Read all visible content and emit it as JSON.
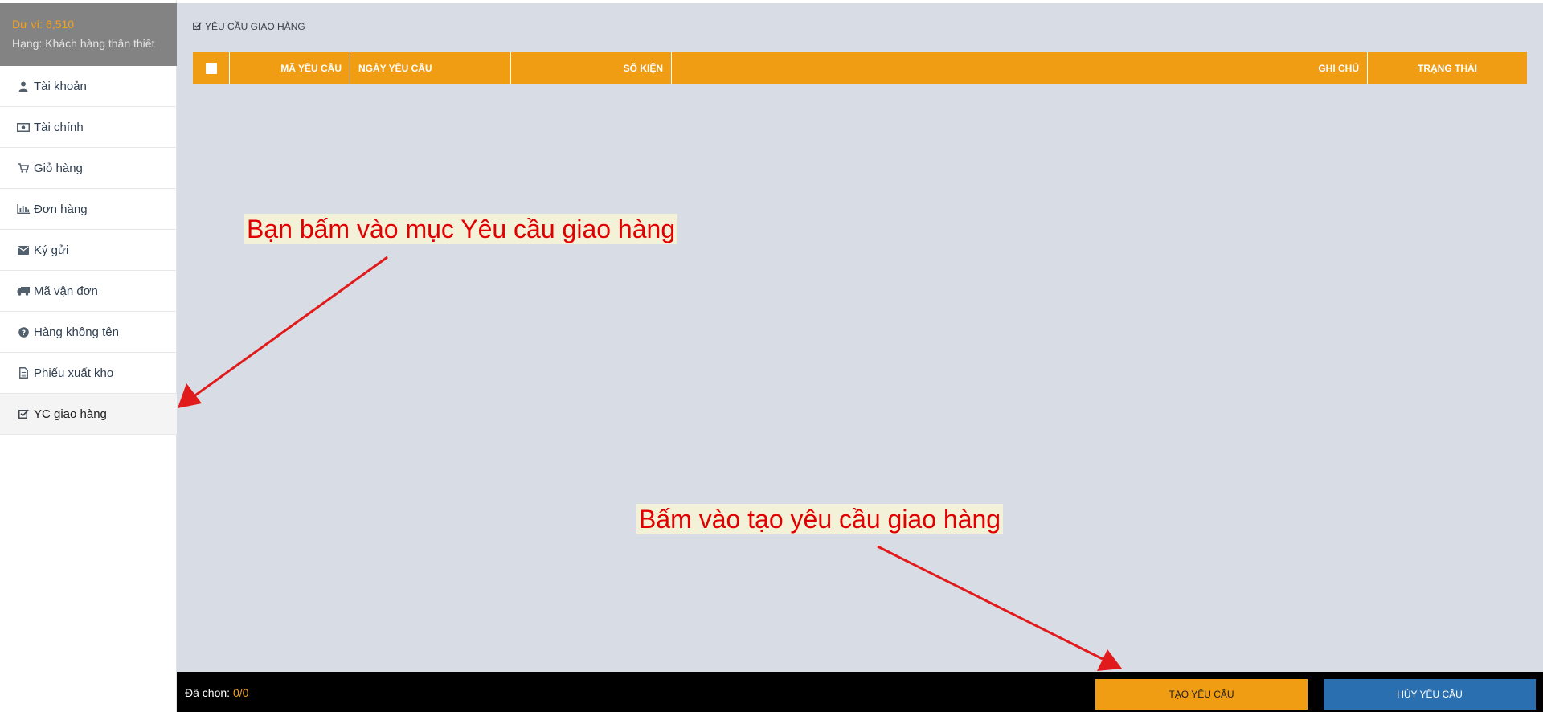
{
  "sidebar": {
    "balance_label": "Dư ví:",
    "balance_value": "6,510",
    "rank": "Hạng: Khách hàng thân thiết",
    "items": [
      {
        "label": "Tài khoản",
        "icon": "user-icon"
      },
      {
        "label": "Tài chính",
        "icon": "money-icon"
      },
      {
        "label": "Giỏ hàng",
        "icon": "cart-icon"
      },
      {
        "label": "Đơn hàng",
        "icon": "bar-chart-icon"
      },
      {
        "label": "Ký gửi",
        "icon": "envelope-icon"
      },
      {
        "label": "Mã vận đơn",
        "icon": "truck-icon"
      },
      {
        "label": "Hàng không tên",
        "icon": "question-circle-icon"
      },
      {
        "label": "Phiếu xuất kho",
        "icon": "file-icon"
      },
      {
        "label": "YC giao hàng",
        "icon": "check-square-icon",
        "active": true
      }
    ]
  },
  "main": {
    "section_title": "YÊU CẦU GIAO HÀNG",
    "table": {
      "headers": [
        "MÃ YÊU CẦU",
        "NGÀY YÊU CẦU",
        "SỐ KIỆN",
        "GHI CHÚ",
        "TRẠNG THÁI"
      ],
      "rows": []
    }
  },
  "footer": {
    "selected_label": "Đã chọn:",
    "selected_count": "0/0",
    "create_button": "TẠO YÊU CẦU",
    "cancel_button": "HỦY YÊU CẦU"
  },
  "annotations": {
    "note_1": "Bạn bấm vào mục Yêu cầu giao hàng",
    "note_2": "Bấm vào tạo yêu cầu giao hàng"
  },
  "colors": {
    "accent": "#f19d13",
    "primary": "#2a6fb0",
    "annotation": "#e00000"
  }
}
